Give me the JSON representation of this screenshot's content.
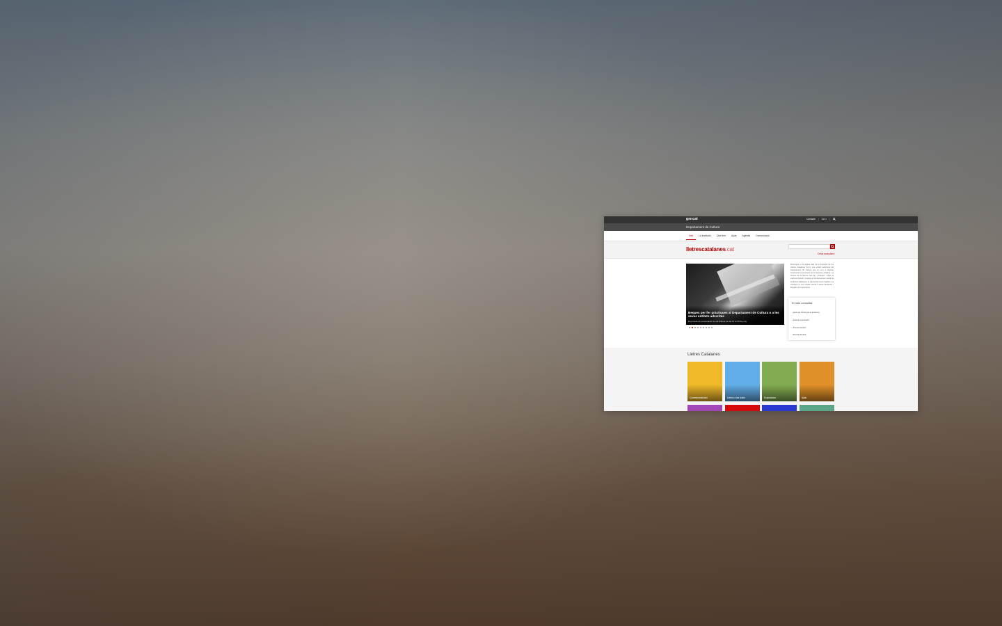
{
  "site": {
    "topbar": {
      "brand": "gencat",
      "contact_label": "Contacte",
      "lang_label": "CA ∨",
      "separator": "|"
    },
    "department": "Departament de Cultura",
    "nav": {
      "items": [
        "Inici",
        "La institució",
        "Què fem",
        "Ajuts",
        "Agenda",
        "Comunicació"
      ]
    },
    "logo": {
      "main": "lletrescatalanes",
      "suffix": ".cat"
    },
    "search": {
      "placeholder": "",
      "advanced_label": "Cerca avançada ›"
    },
    "hero": {
      "title": "Beques per fer pràctiques al Departament de Cultura o a les seves entitats adscrites",
      "subtitle": "El període de presentació de sol·licituds és del 14 al 25 de juny.",
      "dot_count": 9,
      "active_dot": 2
    },
    "intro_text": "Benvinguts a la pàgina web de la Institució de les Lletres Catalanes (ILC), una entitat autònoma del Departament de Cultura que té com a objectiu fonamental la promoció de la literatura catalana i el foment de la lectura, que fa i protegeix i difon el patrimoni literari i impulsa el reconeixement social de les lletres catalanes i el suport dels seus creadors. La Institució té una mirada oberta a altres literatures i llengües a la seva tasca.",
    "popular": {
      "title": "El més consultat",
      "items": [
        "Ajuts de l'Àmbit de la Institució",
        "Lletres a les Aules",
        "Premis literaris",
        "Escola literària"
      ]
    },
    "section_title": "Lletres Catalanes",
    "tiles": [
      {
        "label": "Commemoracions",
        "color": "#f0b92a"
      },
      {
        "label": "Lletres a les Aules",
        "color": "#62aee8"
      },
      {
        "label": "Exposicions",
        "color": "#82ac50"
      },
      {
        "label": "Ajuts",
        "color": "#e09028"
      },
      {
        "label": "",
        "color": "#a347b8"
      },
      {
        "label": "",
        "color": "#d40a0a"
      },
      {
        "label": "",
        "color": "#2a3ad0"
      },
      {
        "label": "",
        "color": "#5ba688"
      }
    ]
  }
}
